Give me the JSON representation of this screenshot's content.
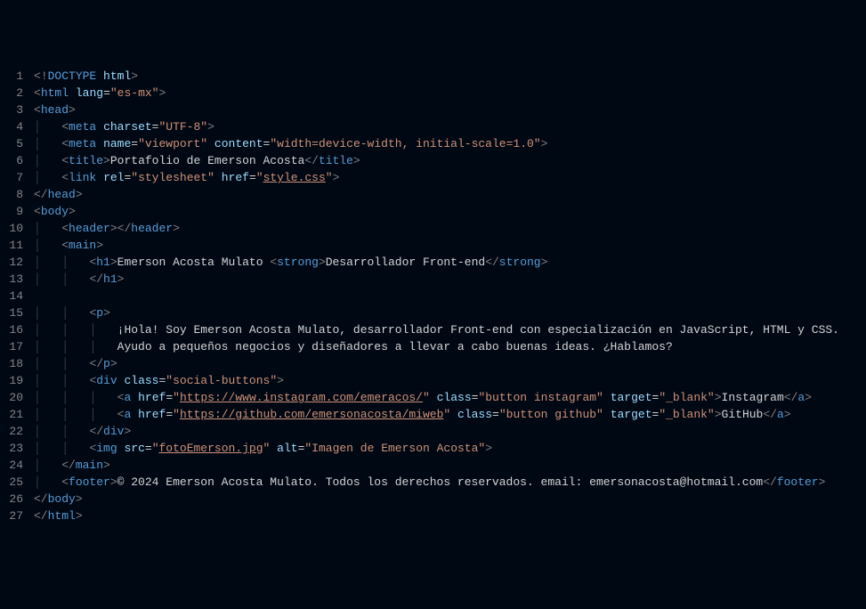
{
  "lines": [
    {
      "n": 1,
      "indent": "",
      "tokens": [
        [
          "tag-bracket",
          "<"
        ],
        [
          "doctype-kw",
          "!"
        ],
        [
          "doctype",
          "DOCTYPE"
        ],
        [
          "attr-name",
          " html"
        ],
        [
          "tag-bracket",
          ">"
        ]
      ]
    },
    {
      "n": 2,
      "indent": "",
      "tokens": [
        [
          "tag-bracket",
          "<"
        ],
        [
          "tag-name",
          "html"
        ],
        [
          "text",
          " "
        ],
        [
          "attr-name",
          "lang"
        ],
        [
          "attr-eq",
          "="
        ],
        [
          "attr-value",
          "\"es-mx\""
        ],
        [
          "tag-bracket",
          ">"
        ]
      ]
    },
    {
      "n": 3,
      "indent": "",
      "tokens": [
        [
          "tag-bracket",
          "<"
        ],
        [
          "tag-name",
          "head"
        ],
        [
          "tag-bracket",
          ">"
        ]
      ]
    },
    {
      "n": 4,
      "indent": "    ",
      "guide": true,
      "tokens": [
        [
          "tag-bracket",
          "<"
        ],
        [
          "tag-name",
          "meta"
        ],
        [
          "text",
          " "
        ],
        [
          "attr-name",
          "charset"
        ],
        [
          "attr-eq",
          "="
        ],
        [
          "attr-value",
          "\"UTF-8\""
        ],
        [
          "tag-bracket",
          ">"
        ]
      ]
    },
    {
      "n": 5,
      "indent": "    ",
      "guide": true,
      "tokens": [
        [
          "tag-bracket",
          "<"
        ],
        [
          "tag-name",
          "meta"
        ],
        [
          "text",
          " "
        ],
        [
          "attr-name",
          "name"
        ],
        [
          "attr-eq",
          "="
        ],
        [
          "attr-value",
          "\"viewport\""
        ],
        [
          "text",
          " "
        ],
        [
          "attr-name",
          "content"
        ],
        [
          "attr-eq",
          "="
        ],
        [
          "attr-value",
          "\"width=device-width, initial-scale=1.0\""
        ],
        [
          "tag-bracket",
          ">"
        ]
      ]
    },
    {
      "n": 6,
      "indent": "    ",
      "guide": true,
      "tokens": [
        [
          "tag-bracket",
          "<"
        ],
        [
          "tag-name",
          "title"
        ],
        [
          "tag-bracket",
          ">"
        ],
        [
          "text",
          "Portafolio de Emerson Acosta"
        ],
        [
          "tag-bracket",
          "</"
        ],
        [
          "tag-name",
          "title"
        ],
        [
          "tag-bracket",
          ">"
        ]
      ]
    },
    {
      "n": 7,
      "indent": "    ",
      "guide": true,
      "tokens": [
        [
          "tag-bracket",
          "<"
        ],
        [
          "tag-name",
          "link"
        ],
        [
          "text",
          " "
        ],
        [
          "attr-name",
          "rel"
        ],
        [
          "attr-eq",
          "="
        ],
        [
          "attr-value",
          "\"stylesheet\""
        ],
        [
          "text",
          " "
        ],
        [
          "attr-name",
          "href"
        ],
        [
          "attr-eq",
          "="
        ],
        [
          "attr-value",
          "\""
        ],
        [
          "attr-value underline",
          "style.css"
        ],
        [
          "attr-value",
          "\""
        ],
        [
          "tag-bracket",
          ">"
        ]
      ]
    },
    {
      "n": 8,
      "indent": "",
      "tokens": [
        [
          "tag-bracket",
          "</"
        ],
        [
          "tag-name",
          "head"
        ],
        [
          "tag-bracket",
          ">"
        ]
      ]
    },
    {
      "n": 9,
      "indent": "",
      "tokens": [
        [
          "tag-bracket",
          "<"
        ],
        [
          "tag-name",
          "body"
        ],
        [
          "tag-bracket",
          ">"
        ]
      ]
    },
    {
      "n": 10,
      "indent": "    ",
      "guide": true,
      "tokens": [
        [
          "tag-bracket",
          "<"
        ],
        [
          "tag-name",
          "header"
        ],
        [
          "tag-bracket",
          ">"
        ],
        [
          "tag-bracket",
          "</"
        ],
        [
          "tag-name",
          "header"
        ],
        [
          "tag-bracket",
          ">"
        ]
      ]
    },
    {
      "n": 11,
      "indent": "    ",
      "guide": true,
      "tokens": [
        [
          "tag-bracket",
          "<"
        ],
        [
          "tag-name",
          "main"
        ],
        [
          "tag-bracket",
          ">"
        ]
      ]
    },
    {
      "n": 12,
      "indent": "        ",
      "guide": true,
      "guide2": true,
      "tokens": [
        [
          "tag-bracket",
          "<"
        ],
        [
          "tag-name",
          "h1"
        ],
        [
          "tag-bracket",
          ">"
        ],
        [
          "text",
          "Emerson Acosta Mulato "
        ],
        [
          "tag-bracket",
          "<"
        ],
        [
          "tag-name",
          "strong"
        ],
        [
          "tag-bracket",
          ">"
        ],
        [
          "text",
          "Desarrollador Front-end"
        ],
        [
          "tag-bracket",
          "</"
        ],
        [
          "tag-name",
          "strong"
        ],
        [
          "tag-bracket",
          ">"
        ]
      ]
    },
    {
      "n": 13,
      "indent": "        ",
      "guide": true,
      "guide2": true,
      "tokens": [
        [
          "tag-bracket",
          "</"
        ],
        [
          "tag-name",
          "h1"
        ],
        [
          "tag-bracket",
          ">"
        ]
      ]
    },
    {
      "n": 14,
      "indent": "",
      "guide": true,
      "guide2": true,
      "tokens": []
    },
    {
      "n": 15,
      "indent": "        ",
      "guide": true,
      "guide2": true,
      "tokens": [
        [
          "tag-bracket",
          "<"
        ],
        [
          "tag-name",
          "p"
        ],
        [
          "tag-bracket",
          ">"
        ]
      ]
    },
    {
      "n": 16,
      "indent": "            ",
      "guide": true,
      "guide2": true,
      "guide3": true,
      "tokens": [
        [
          "text",
          "¡Hola! Soy Emerson Acosta Mulato, desarrollador Front-end con especialización en JavaScript, HTML y CSS."
        ]
      ]
    },
    {
      "n": 17,
      "indent": "            ",
      "guide": true,
      "guide2": true,
      "guide3": true,
      "tokens": [
        [
          "text",
          "Ayudo a pequeños negocios y diseñadores a llevar a cabo buenas ideas. ¿Hablamos?"
        ]
      ]
    },
    {
      "n": 18,
      "indent": "        ",
      "guide": true,
      "guide2": true,
      "tokens": [
        [
          "tag-bracket",
          "</"
        ],
        [
          "tag-name",
          "p"
        ],
        [
          "tag-bracket",
          ">"
        ]
      ]
    },
    {
      "n": 19,
      "indent": "        ",
      "guide": true,
      "guide2": true,
      "tokens": [
        [
          "tag-bracket",
          "<"
        ],
        [
          "tag-name",
          "div"
        ],
        [
          "text",
          " "
        ],
        [
          "attr-name",
          "class"
        ],
        [
          "attr-eq",
          "="
        ],
        [
          "attr-value",
          "\"social-buttons\""
        ],
        [
          "tag-bracket",
          ">"
        ]
      ]
    },
    {
      "n": 20,
      "indent": "            ",
      "guide": true,
      "guide2": true,
      "guide3": true,
      "tokens": [
        [
          "tag-bracket",
          "<"
        ],
        [
          "tag-name",
          "a"
        ],
        [
          "text",
          " "
        ],
        [
          "attr-name",
          "href"
        ],
        [
          "attr-eq",
          "="
        ],
        [
          "attr-value",
          "\""
        ],
        [
          "attr-value underline",
          "https://www.instagram.com/emeracos/"
        ],
        [
          "attr-value",
          "\""
        ],
        [
          "text",
          " "
        ],
        [
          "attr-name",
          "class"
        ],
        [
          "attr-eq",
          "="
        ],
        [
          "attr-value",
          "\"button instagram\""
        ],
        [
          "text",
          " "
        ],
        [
          "attr-name",
          "target"
        ],
        [
          "attr-eq",
          "="
        ],
        [
          "attr-value",
          "\"_blank\""
        ],
        [
          "tag-bracket",
          ">"
        ],
        [
          "text",
          "Instagram"
        ],
        [
          "tag-bracket",
          "</"
        ],
        [
          "tag-name",
          "a"
        ],
        [
          "tag-bracket",
          ">"
        ]
      ]
    },
    {
      "n": 21,
      "indent": "            ",
      "guide": true,
      "guide2": true,
      "guide3": true,
      "tokens": [
        [
          "tag-bracket",
          "<"
        ],
        [
          "tag-name",
          "a"
        ],
        [
          "text",
          " "
        ],
        [
          "attr-name",
          "href"
        ],
        [
          "attr-eq",
          "="
        ],
        [
          "attr-value",
          "\""
        ],
        [
          "attr-value underline",
          "https://github.com/emersonacosta/miweb"
        ],
        [
          "attr-value",
          "\""
        ],
        [
          "text",
          " "
        ],
        [
          "attr-name",
          "class"
        ],
        [
          "attr-eq",
          "="
        ],
        [
          "attr-value",
          "\"button github\""
        ],
        [
          "text",
          " "
        ],
        [
          "attr-name",
          "target"
        ],
        [
          "attr-eq",
          "="
        ],
        [
          "attr-value",
          "\"_blank\""
        ],
        [
          "tag-bracket",
          ">"
        ],
        [
          "text",
          "GitHub"
        ],
        [
          "tag-bracket",
          "</"
        ],
        [
          "tag-name",
          "a"
        ],
        [
          "tag-bracket",
          ">"
        ]
      ]
    },
    {
      "n": 22,
      "indent": "        ",
      "guide": true,
      "guide2": true,
      "tokens": [
        [
          "tag-bracket",
          "</"
        ],
        [
          "tag-name",
          "div"
        ],
        [
          "tag-bracket",
          ">"
        ]
      ]
    },
    {
      "n": 23,
      "indent": "        ",
      "guide": true,
      "guide2": true,
      "tokens": [
        [
          "tag-bracket",
          "<"
        ],
        [
          "tag-name",
          "img"
        ],
        [
          "text",
          " "
        ],
        [
          "attr-name",
          "src"
        ],
        [
          "attr-eq",
          "="
        ],
        [
          "attr-value",
          "\""
        ],
        [
          "attr-value underline",
          "fotoEmerson.jpg"
        ],
        [
          "attr-value",
          "\""
        ],
        [
          "text",
          " "
        ],
        [
          "attr-name",
          "alt"
        ],
        [
          "attr-eq",
          "="
        ],
        [
          "attr-value",
          "\"Imagen de Emerson Acosta\""
        ],
        [
          "tag-bracket",
          ">"
        ]
      ]
    },
    {
      "n": 24,
      "indent": "    ",
      "guide": true,
      "tokens": [
        [
          "tag-bracket",
          "</"
        ],
        [
          "tag-name",
          "main"
        ],
        [
          "tag-bracket",
          ">"
        ]
      ]
    },
    {
      "n": 25,
      "indent": "    ",
      "guide": true,
      "tokens": [
        [
          "tag-bracket",
          "<"
        ],
        [
          "tag-name",
          "footer"
        ],
        [
          "tag-bracket",
          ">"
        ],
        [
          "text",
          "© 2024 Emerson Acosta Mulato. Todos los derechos reservados. email: emersonacosta@hotmail.com"
        ],
        [
          "tag-bracket",
          "</"
        ],
        [
          "tag-name",
          "footer"
        ],
        [
          "tag-bracket",
          ">"
        ]
      ]
    },
    {
      "n": 26,
      "indent": "",
      "tokens": [
        [
          "tag-bracket",
          "</"
        ],
        [
          "tag-name",
          "body"
        ],
        [
          "tag-bracket",
          ">"
        ]
      ]
    },
    {
      "n": 27,
      "indent": "",
      "tokens": [
        [
          "tag-bracket",
          "</"
        ],
        [
          "tag-name",
          "html"
        ],
        [
          "tag-bracket",
          ">"
        ]
      ]
    }
  ]
}
